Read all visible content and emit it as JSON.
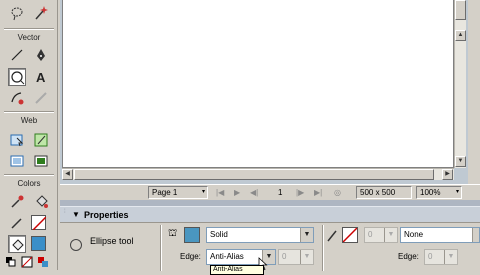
{
  "toolbar": {
    "sections": {
      "vector": "Vector",
      "web": "Web",
      "colors": "Colors"
    },
    "stroke_color": "#cc0000",
    "fill_color": "#3b8fc8"
  },
  "status": {
    "page": "Page 1",
    "frame": "1",
    "size": "500 x 500",
    "zoom": "100%"
  },
  "properties": {
    "title": "Properties",
    "tool_name": "Ellipse tool",
    "fill_type": "Solid",
    "fill_color": "#4a96c0",
    "edge_label": "Edge:",
    "edge_value": "Anti-Alias",
    "feather_value": "0",
    "stroke_value": "0",
    "stroke_type": "None",
    "stroke_edge_label": "Edge:",
    "stroke_edge_value": "0",
    "tooltip": "Anti-Alias"
  }
}
